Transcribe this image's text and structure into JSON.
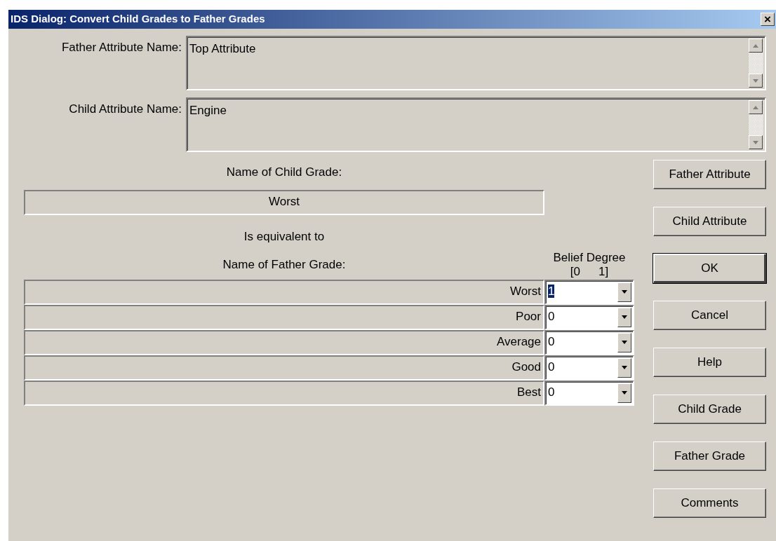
{
  "window": {
    "title": "IDS Dialog: Convert Child Grades to Father Grades",
    "close": "×"
  },
  "attributes": [
    {
      "label": "Father Attribute Name:",
      "value": "Top Attribute"
    },
    {
      "label": "Child Attribute Name:",
      "value": "Engine"
    }
  ],
  "child_grade": {
    "label": "Name of Child Grade:",
    "value": "Worst"
  },
  "equivalent_text": "Is equivalent to",
  "father_grade_label": "Name of Father Grade:",
  "belief_header": {
    "title": "Belief Degree",
    "scale_min": "[0",
    "scale_max": "1]"
  },
  "grades": [
    {
      "name": "Worst",
      "degree": "1",
      "focused": true
    },
    {
      "name": "Poor",
      "degree": "0",
      "focused": false
    },
    {
      "name": "Average",
      "degree": "0",
      "focused": false
    },
    {
      "name": "Good",
      "degree": "0",
      "focused": false
    },
    {
      "name": "Best",
      "degree": "0",
      "focused": false
    }
  ],
  "buttons": [
    {
      "label": "Father Attribute",
      "default": false
    },
    {
      "label": "Child Attribute",
      "default": false
    },
    {
      "label": "OK",
      "default": true
    },
    {
      "label": "Cancel",
      "default": false
    },
    {
      "label": "Help",
      "default": false
    },
    {
      "label": "Child Grade",
      "default": false
    },
    {
      "label": "Father Grade",
      "default": false
    },
    {
      "label": "Comments",
      "default": false
    }
  ]
}
